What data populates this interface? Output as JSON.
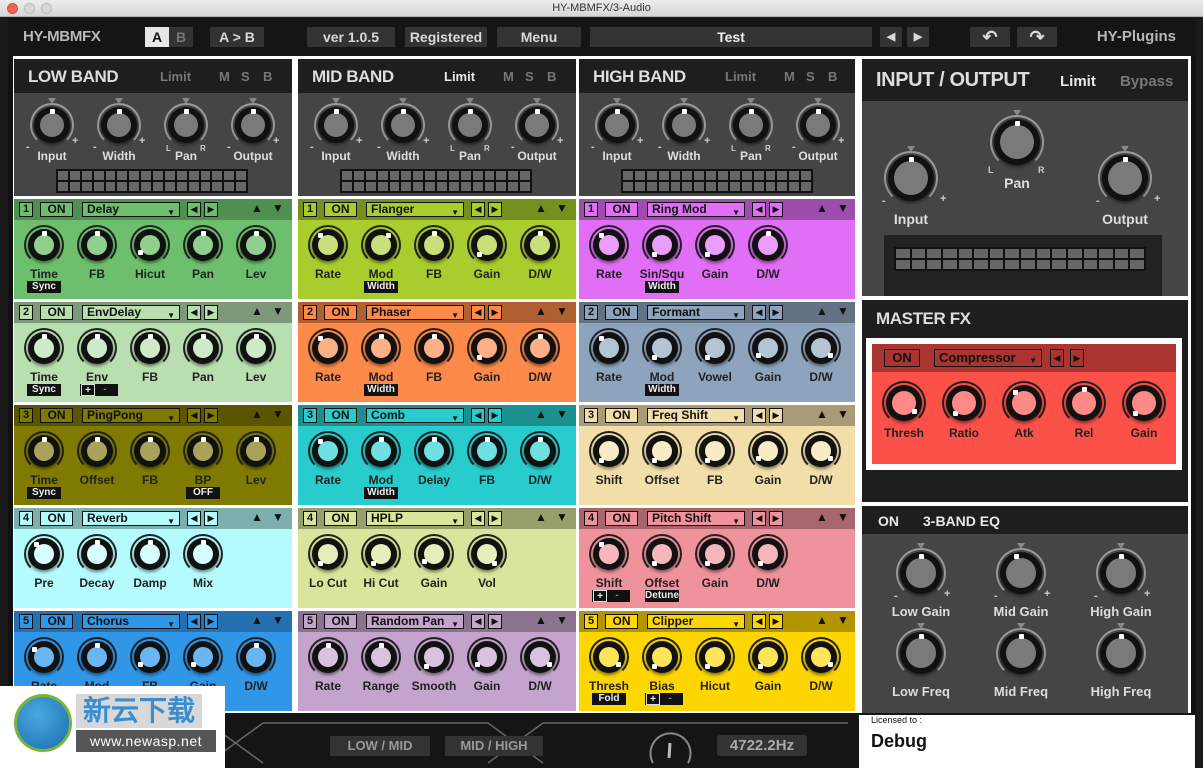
{
  "window": {
    "title": "HY-MBMFX/3-Audio"
  },
  "topbar": {
    "brand": "HY-MBMFX",
    "ab_a": "A",
    "ab_b": "B",
    "copy_ab": "A > B",
    "version": "ver 1.0.5",
    "registered": "Registered",
    "menu": "Menu",
    "preset_name": "Test",
    "prev_icon": "◀",
    "next_icon": "▶",
    "undo_icon": "↶",
    "redo_icon": "↷",
    "vendor": "HY-Plugins"
  },
  "bands": [
    {
      "title": "LOW BAND",
      "limit": "Limit",
      "limit_active": false,
      "m": "M",
      "s": "S",
      "b": "B",
      "knobs": [
        {
          "label": "Input",
          "min": "-",
          "max": "+"
        },
        {
          "label": "Width",
          "min": "-",
          "max": "+"
        },
        {
          "label": "Pan",
          "min": "L",
          "max": "R"
        },
        {
          "label": "Output",
          "min": "-",
          "max": "+"
        }
      ]
    },
    {
      "title": "MID BAND",
      "limit": "Limit",
      "limit_active": true,
      "m": "M",
      "s": "S",
      "b": "B",
      "knobs": [
        {
          "label": "Input",
          "min": "-",
          "max": "+"
        },
        {
          "label": "Width",
          "min": "-",
          "max": "+"
        },
        {
          "label": "Pan",
          "min": "L",
          "max": "R"
        },
        {
          "label": "Output",
          "min": "-",
          "max": "+"
        }
      ]
    },
    {
      "title": "HIGH BAND",
      "limit": "Limit",
      "limit_active": false,
      "m": "M",
      "s": "S",
      "b": "B",
      "knobs": [
        {
          "label": "Input",
          "min": "-",
          "max": "+"
        },
        {
          "label": "Width",
          "min": "-",
          "max": "+"
        },
        {
          "label": "Pan",
          "min": "L",
          "max": "R"
        },
        {
          "label": "Output",
          "min": "-",
          "max": "+"
        }
      ]
    }
  ],
  "io": {
    "title": "INPUT / OUTPUT",
    "limit": "Limit",
    "bypass": "Bypass",
    "knobs": [
      {
        "label": "Input",
        "min": "-",
        "max": "+"
      },
      {
        "label": "Pan",
        "min": "L",
        "max": "R"
      },
      {
        "label": "Output",
        "min": "-",
        "max": "+"
      }
    ]
  },
  "slots": [
    [
      {
        "num": "1",
        "on": "ON",
        "effect": "Delay",
        "color": "#6dbf6d",
        "head": "#4f8f4f",
        "cap": "#8fd08f",
        "knobs": [
          "Time",
          "FB",
          "Hicut",
          "Pan",
          "Lev"
        ],
        "tags": [
          {
            "under": 0,
            "text": "Sync"
          }
        ]
      },
      {
        "num": "2",
        "on": "ON",
        "effect": "EnvDelay",
        "color": "#b9dfb0",
        "head": "#7c9a78",
        "cap": "#cfeac8",
        "knobs": [
          "Time",
          "Env",
          "FB",
          "Pan",
          "Lev"
        ],
        "tags": [
          {
            "under": 0,
            "text": "Sync"
          }
        ],
        "plusminus": {
          "under": 1,
          "plus": "+",
          "minus": "-"
        }
      },
      {
        "num": "3",
        "on": "ON",
        "effect": "PingPong",
        "color": "#7f7a00",
        "head": "#5a5600",
        "cap": "#a9a25a",
        "knobs": [
          "Time",
          "Offset",
          "FB",
          "BP",
          "Lev"
        ],
        "tags": [
          {
            "under": 0,
            "text": "Sync"
          },
          {
            "under": 3,
            "text": "OFF"
          }
        ]
      },
      {
        "num": "4",
        "on": "ON",
        "effect": "Reverb",
        "color": "#b4fbfd",
        "head": "#7eafaf",
        "cap": "#d6feff",
        "knobs": [
          "Pre",
          "Decay",
          "Damp",
          "Mix"
        ],
        "tags": []
      },
      {
        "num": "5",
        "on": "ON",
        "effect": "Chorus",
        "color": "#2f96e8",
        "head": "#2470b0",
        "cap": "#6ab6f2",
        "knobs": [
          "Rate",
          "Mod",
          "FB",
          "Gain",
          "D/W"
        ],
        "tags": []
      }
    ],
    [
      {
        "num": "1",
        "on": "ON",
        "effect": "Flanger",
        "color": "#a8cd2c",
        "head": "#76901f",
        "cap": "#c7e07a",
        "knobs": [
          "Rate",
          "Mod",
          "FB",
          "Gain",
          "D/W"
        ],
        "tags": [
          {
            "under": 1,
            "text": "Width"
          }
        ]
      },
      {
        "num": "2",
        "on": "ON",
        "effect": "Phaser",
        "color": "#fd8a4a",
        "head": "#b06032",
        "cap": "#fdb088",
        "knobs": [
          "Rate",
          "Mod",
          "FB",
          "Gain",
          "D/W"
        ],
        "tags": [
          {
            "under": 1,
            "text": "Width"
          }
        ]
      },
      {
        "num": "3",
        "on": "ON",
        "effect": "Comb",
        "color": "#28cccc",
        "head": "#1c8f8f",
        "cap": "#6ee0e0",
        "knobs": [
          "Rate",
          "Mod",
          "Delay",
          "FB",
          "D/W"
        ],
        "tags": [
          {
            "under": 1,
            "text": "Width"
          }
        ]
      },
      {
        "num": "4",
        "on": "ON",
        "effect": "HPLP",
        "color": "#d8e59a",
        "head": "#97a06b",
        "cap": "#e6efbc",
        "knobs": [
          "Lo Cut",
          "Hi Cut",
          "Gain",
          "Vol"
        ],
        "tags": []
      },
      {
        "num": "5",
        "on": "ON",
        "effect": "Random Pan",
        "color": "#c4a4cc",
        "head": "#89738f",
        "cap": "#d8c2dd",
        "knobs": [
          "Rate",
          "Range",
          "Smooth",
          "Gain",
          "D/W"
        ],
        "tags": []
      }
    ],
    [
      {
        "num": "1",
        "on": "ON",
        "effect": "Ring Mod",
        "color": "#e06ef6",
        "head": "#9d4dac",
        "cap": "#eb9ef9",
        "knobs": [
          "Rate",
          "Sin/Squ",
          "Gain",
          "D/W"
        ],
        "tags": [
          {
            "under": 1,
            "text": "Width"
          }
        ]
      },
      {
        "num": "2",
        "on": "ON",
        "effect": "Formant",
        "color": "#8ea4bd",
        "head": "#637384",
        "cap": "#b4c4d4",
        "knobs": [
          "Rate",
          "Mod",
          "Vowel",
          "Gain",
          "D/W"
        ],
        "tags": [
          {
            "under": 1,
            "text": "Width"
          }
        ]
      },
      {
        "num": "3",
        "on": "ON",
        "effect": "Freq Shift",
        "color": "#f2dea8",
        "head": "#a99b75",
        "cap": "#f8ecc8",
        "knobs": [
          "Shift",
          "Offset",
          "FB",
          "Gain",
          "D/W"
        ],
        "tags": []
      },
      {
        "num": "4",
        "on": "ON",
        "effect": "Pitch Shift",
        "color": "#ef929c",
        "head": "#a7666d",
        "cap": "#f5b6bc",
        "knobs": [
          "Shift",
          "Offset",
          "Gain",
          "D/W"
        ],
        "tags": [
          {
            "under": 1,
            "text": "Detune"
          }
        ],
        "plusminus": {
          "under": 0,
          "plus": "+",
          "minus": "-"
        }
      },
      {
        "num": "5",
        "on": "ON",
        "effect": "Clipper",
        "color": "#fdd600",
        "head": "#b19600",
        "cap": "#fde458",
        "knobs": [
          "Thresh",
          "Bias",
          "Hicut",
          "Gain",
          "D/W"
        ],
        "tags": [
          {
            "under": 0,
            "text": "Fold"
          }
        ],
        "plusminus": {
          "under": 1,
          "plus": "+",
          "minus": "-"
        }
      }
    ]
  ],
  "master": {
    "title": "MASTER FX",
    "on": "ON",
    "effect": "Compressor",
    "knobs": [
      "Thresh",
      "Ratio",
      "Atk",
      "Rel",
      "Gain"
    ]
  },
  "eq": {
    "on": "ON",
    "title": "3-BAND EQ",
    "knobs": [
      {
        "label": "Low Gain",
        "min": "-",
        "max": "+"
      },
      {
        "label": "Mid Gain",
        "min": "-",
        "max": "+"
      },
      {
        "label": "High Gain",
        "min": "-",
        "max": "+"
      },
      {
        "label": "Low Freq"
      },
      {
        "label": "Mid Freq"
      },
      {
        "label": "High Freq"
      }
    ]
  },
  "crossover": {
    "low_mid": "LOW / MID",
    "mid_high": "MID / HIGH",
    "frequency": "4722.2Hz"
  },
  "license": {
    "label": "Licensed to :",
    "name": "Debug"
  },
  "watermark": {
    "brand": "新云下载",
    "url": "www.newasp.net"
  }
}
